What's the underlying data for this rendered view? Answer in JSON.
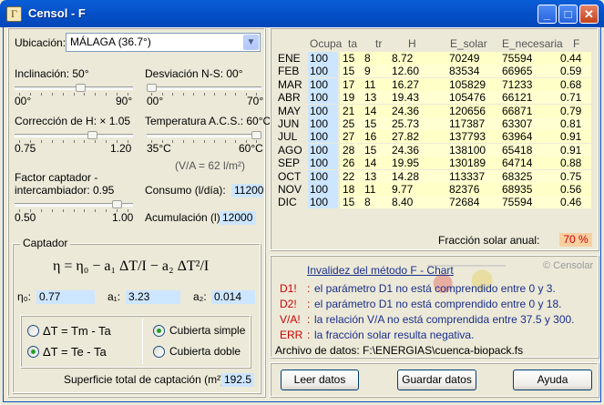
{
  "window": {
    "title": "Censol - F",
    "app_icon_glyph": "Γ"
  },
  "left": {
    "ubicacion_label": "Ubicación:",
    "ubicacion_value": "MÁLAGA  (36.7°)",
    "inclinacion_label": "Inclinación: 50°",
    "inclinacion_min": "00°",
    "inclinacion_max": "90°",
    "inclinacion_level": 0.56,
    "desviacion_label": "Desviación N-S: 00°",
    "desviacion_min": "00°",
    "desviacion_max": "70°",
    "desviacion_level": 0.0,
    "correccion_label": "Corrección de H: × 1.05",
    "correccion_min": "0.75",
    "correccion_max": "1.20",
    "correccion_level": 0.67,
    "temperatura_label": "Temperatura A.C.S.: 60°C",
    "temperatura_min": "35°C",
    "temperatura_max": "60°C",
    "temperatura_level": 1.0,
    "va_text": "(V/A = 62 l/m²)",
    "factor_label_1": "Factor captador -",
    "factor_label_2": "intercambiador:",
    "factor_value": "0.95",
    "factor_min": "0.50",
    "factor_max": "1.00",
    "factor_level": 0.9,
    "consumo_label": "Consumo (l/día):",
    "consumo_value": "11200",
    "acumulacion_label": "Acumulación (l):",
    "acumulacion_value": "12000",
    "captador_title": "Captador",
    "formula": "η = η₀ − a₁ ΔT/I − a₂ ΔT²/I",
    "eta0_label": "η₀:",
    "eta0_value": "0.77",
    "a1_label": "a₁:",
    "a1_value": "3.23",
    "a2_label": "a₂:",
    "a2_value": "0.014",
    "dt_option_1": "ΔT = Tm - Ta",
    "dt_option_1_selected": false,
    "dt_option_2": "ΔT = Te - Ta",
    "dt_option_2_selected": true,
    "cubierta_simple": "Cubierta simple",
    "cubierta_simple_selected": true,
    "cubierta_doble": "Cubierta doble",
    "cubierta_doble_selected": false,
    "superficie_label": "Superficie total de captación (m²):",
    "superficie_value": "192.5"
  },
  "table": {
    "headers": [
      "Ocupa",
      "ta",
      "tr",
      "H",
      "E_solar",
      "E_necesaria",
      "F"
    ],
    "rows": [
      {
        "mes": "ENE",
        "ocupa": "100",
        "ta": "15",
        "tr": "8",
        "h": "8.72",
        "esolar": "70249",
        "enec": "75594",
        "f": "0.44"
      },
      {
        "mes": "FEB",
        "ocupa": "100",
        "ta": "15",
        "tr": "9",
        "h": "12.60",
        "esolar": "83534",
        "enec": "66965",
        "f": "0.59"
      },
      {
        "mes": "MAR",
        "ocupa": "100",
        "ta": "17",
        "tr": "11",
        "h": "16.27",
        "esolar": "105829",
        "enec": "71233",
        "f": "0.68"
      },
      {
        "mes": "ABR",
        "ocupa": "100",
        "ta": "19",
        "tr": "13",
        "h": "19.43",
        "esolar": "105476",
        "enec": "66121",
        "f": "0.71"
      },
      {
        "mes": "MAY",
        "ocupa": "100",
        "ta": "21",
        "tr": "14",
        "h": "24.36",
        "esolar": "120656",
        "enec": "66871",
        "f": "0.79"
      },
      {
        "mes": "JUN",
        "ocupa": "100",
        "ta": "25",
        "tr": "15",
        "h": "25.73",
        "esolar": "117387",
        "enec": "63307",
        "f": "0.81"
      },
      {
        "mes": "JUL",
        "ocupa": "100",
        "ta": "27",
        "tr": "16",
        "h": "27.82",
        "esolar": "137793",
        "enec": "63964",
        "f": "0.91"
      },
      {
        "mes": "AGO",
        "ocupa": "100",
        "ta": "28",
        "tr": "15",
        "h": "24.36",
        "esolar": "138100",
        "enec": "65418",
        "f": "0.91"
      },
      {
        "mes": "SEP",
        "ocupa": "100",
        "ta": "26",
        "tr": "14",
        "h": "19.95",
        "esolar": "130189",
        "enec": "64714",
        "f": "0.88"
      },
      {
        "mes": "OCT",
        "ocupa": "100",
        "ta": "22",
        "tr": "13",
        "h": "14.28",
        "esolar": "113337",
        "enec": "68325",
        "f": "0.75"
      },
      {
        "mes": "NOV",
        "ocupa": "100",
        "ta": "18",
        "tr": "11",
        "h": "9.77",
        "esolar": "82376",
        "enec": "68935",
        "f": "0.56"
      },
      {
        "mes": "DIC",
        "ocupa": "100",
        "ta": "15",
        "tr": "8",
        "h": "8.40",
        "esolar": "72684",
        "enec": "75594",
        "f": "0.46"
      }
    ],
    "fraccion_label": "Fracción solar anual:",
    "fraccion_value": "70 %"
  },
  "info": {
    "watermark": "© Censolar",
    "link": "Invalidez del método F - Chart",
    "errors": [
      {
        "code": "D1!",
        "sep": ":",
        "text": "el parámetro D1 no está comprendido entre 0 y 3."
      },
      {
        "code": "D2!",
        "sep": ":",
        "text": "el parámetro D1 no está comprendido entre 0 y 18."
      },
      {
        "code": "V/A!",
        "sep": ":",
        "text": "la relación V/A no está comprendida entre 37.5 y 300."
      },
      {
        "code": "ERR",
        "sep": ":",
        "text": "la fracción solar resulta negativa."
      }
    ],
    "archivo": "Archivo de datos: F:\\ENERGIAS\\cuenca-biopack.fs"
  },
  "buttons": {
    "leer": "Leer datos",
    "guardar": "Guardar datos",
    "ayuda": "Ayuda"
  },
  "colors": {
    "field_bg": "#CDE6FF",
    "fraccion_bg": "#F7CFA0",
    "error_red": "#C00000",
    "link_blue": "#1A2F8A"
  }
}
